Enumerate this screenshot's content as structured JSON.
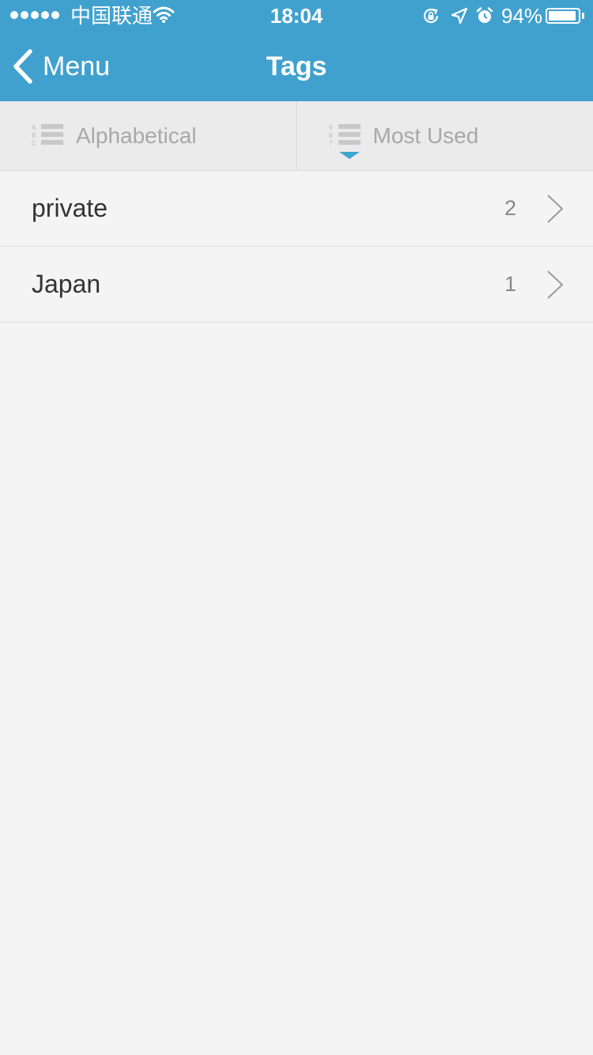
{
  "status_bar": {
    "carrier": "中国联通",
    "time": "18:04",
    "battery_percent": "94%",
    "battery_level": 0.94,
    "signal_dots": 5,
    "icons": [
      "wifi-icon",
      "rotation-lock-icon",
      "location-arrow-icon",
      "alarm-icon",
      "battery-icon"
    ]
  },
  "nav": {
    "back_label": "Menu",
    "title": "Tags"
  },
  "sort_tabs": [
    {
      "label": "Alphabetical",
      "icon_letters": [
        "A",
        "B",
        "C"
      ],
      "selected": false
    },
    {
      "label": "Most Used",
      "icon_letters": [
        "9",
        "8",
        "7"
      ],
      "selected": true
    }
  ],
  "tags": [
    {
      "name": "private",
      "count": "2"
    },
    {
      "name": "Japan",
      "count": "1"
    }
  ],
  "colors": {
    "accent": "#41a1ce",
    "indicator": "#3fa6cf",
    "background": "#f4f4f4",
    "tab_background": "#ebebeb"
  }
}
